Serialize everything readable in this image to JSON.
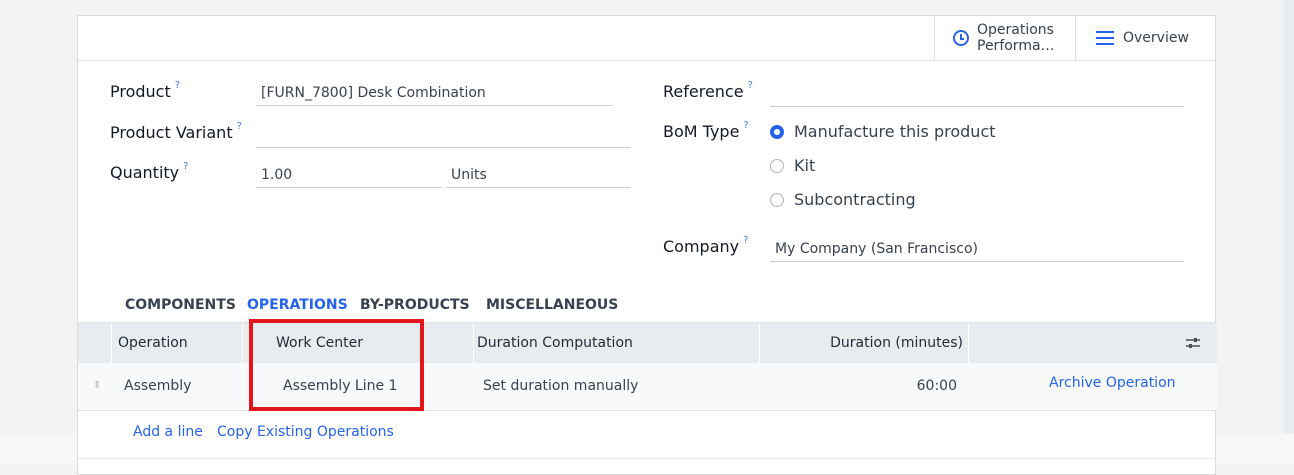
{
  "header": {
    "operations_performance_label": "Operations\nPerforma…",
    "ops_line1": "Operations",
    "ops_line2": "Performa…",
    "overview_label": "Overview"
  },
  "form": {
    "product_label": "Product",
    "product_value": "[FURN_7800] Desk Combination",
    "variant_label": "Product Variant",
    "variant_value": "",
    "quantity_label": "Quantity",
    "quantity_value": "1.00",
    "uom_value": "Units",
    "reference_label": "Reference",
    "reference_value": "",
    "bom_type_label": "BoM Type",
    "bom_type_options": [
      "Manufacture this product",
      "Kit",
      "Subcontracting"
    ],
    "bom_type_selected": "Manufacture this product",
    "company_label": "Company",
    "company_value": "My Company (San Francisco)",
    "help_mark": "?"
  },
  "tabs": [
    "COMPONENTS",
    "OPERATIONS",
    "BY-PRODUCTS",
    "MISCELLANEOUS"
  ],
  "active_tab": "OPERATIONS",
  "table": {
    "columns": [
      "Operation",
      "Work Center",
      "Duration Computation",
      "Duration (minutes)"
    ],
    "rows": [
      {
        "operation": "Assembly",
        "work_center": "Assembly Line 1",
        "duration_computation": "Set duration manually",
        "duration": "60:00",
        "action": "Archive Operation"
      }
    ],
    "add_line": "Add a line",
    "copy_existing": "Copy Existing Operations"
  },
  "colors": {
    "accent": "#2563eb",
    "highlight": "#e5161b"
  }
}
